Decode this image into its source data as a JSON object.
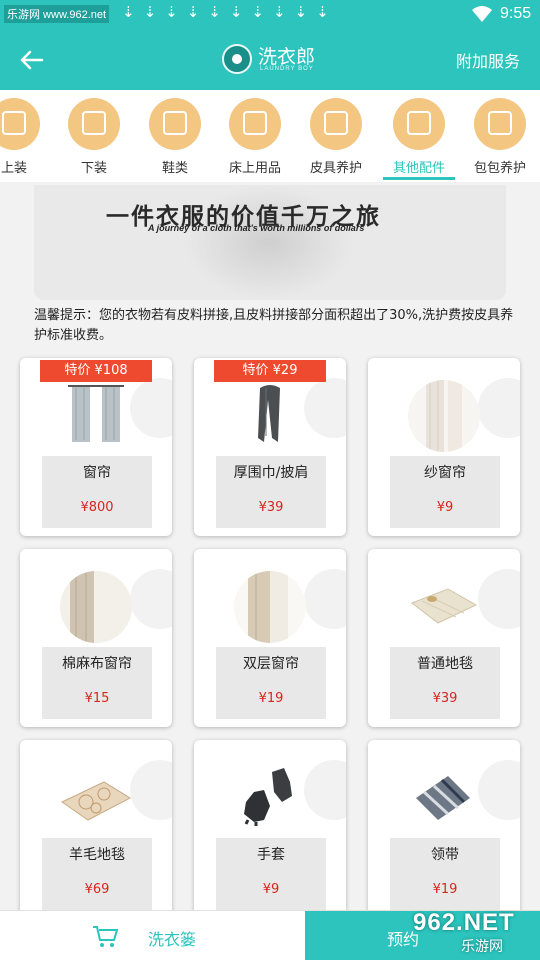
{
  "status_bar": {
    "site_label": "乐游网 www.962.net",
    "time": "9:55",
    "wifi_icon": "wifi-icon",
    "notification_icon": "download-arrow-icon"
  },
  "header": {
    "brand_title": "洗衣郎",
    "brand_subtitle": "LAUNDRY BOY",
    "extra_service": "附加服务",
    "back_icon": "back-arrow-icon"
  },
  "categories": [
    {
      "label": "上装",
      "icon": "shirt-icon",
      "active": false
    },
    {
      "label": "下装",
      "icon": "pants-icon",
      "active": false
    },
    {
      "label": "鞋类",
      "icon": "shoe-icon",
      "active": false
    },
    {
      "label": "床上用品",
      "icon": "bedding-icon",
      "active": false
    },
    {
      "label": "皮具养护",
      "icon": "leather-icon",
      "active": false
    },
    {
      "label": "其他配件",
      "icon": "accessory-icon",
      "active": true
    },
    {
      "label": "包包养护",
      "icon": "bag-icon",
      "active": false
    }
  ],
  "banner": {
    "title": "一件衣服的价值千万之旅",
    "subtitle": "A journey of a cloth that's worth millions of dollars"
  },
  "notice": "温馨提示：您的衣物若有皮料拼接,且皮料拼接部分面积超出了30%,洗护费按皮具养护标准收费。",
  "products": [
    {
      "name": "窗帘",
      "price": "¥800",
      "badge": "特价 ¥108",
      "image": "curtain-image"
    },
    {
      "name": "厚围巾/披肩",
      "price": "¥39",
      "badge": "特价 ¥29",
      "image": "scarf-image"
    },
    {
      "name": "纱窗帘",
      "price": "¥9",
      "badge": "",
      "image": "sheer-curtain-image"
    },
    {
      "name": "棉麻布窗帘",
      "price": "¥15",
      "badge": "",
      "image": "linen-curtain-image"
    },
    {
      "name": "双层窗帘",
      "price": "¥19",
      "badge": "",
      "image": "double-curtain-image"
    },
    {
      "name": "普通地毯",
      "price": "¥39",
      "badge": "",
      "image": "rug-image"
    },
    {
      "name": "羊毛地毯",
      "price": "¥69",
      "badge": "",
      "image": "wool-rug-image"
    },
    {
      "name": "手套",
      "price": "¥9",
      "badge": "",
      "image": "gloves-image"
    },
    {
      "name": "领带",
      "price": "¥19",
      "badge": "",
      "image": "tie-image"
    }
  ],
  "bottom": {
    "cart_label": "洗衣篓",
    "order_label": "预约",
    "cart_icon": "basket-icon"
  },
  "watermark": {
    "text": "962.NET",
    "sub": "乐游网"
  },
  "colors": {
    "primary": "#2cc4bd",
    "category_circle": "#f3c681",
    "badge": "#ee4a2f",
    "price": "#d9251d"
  }
}
